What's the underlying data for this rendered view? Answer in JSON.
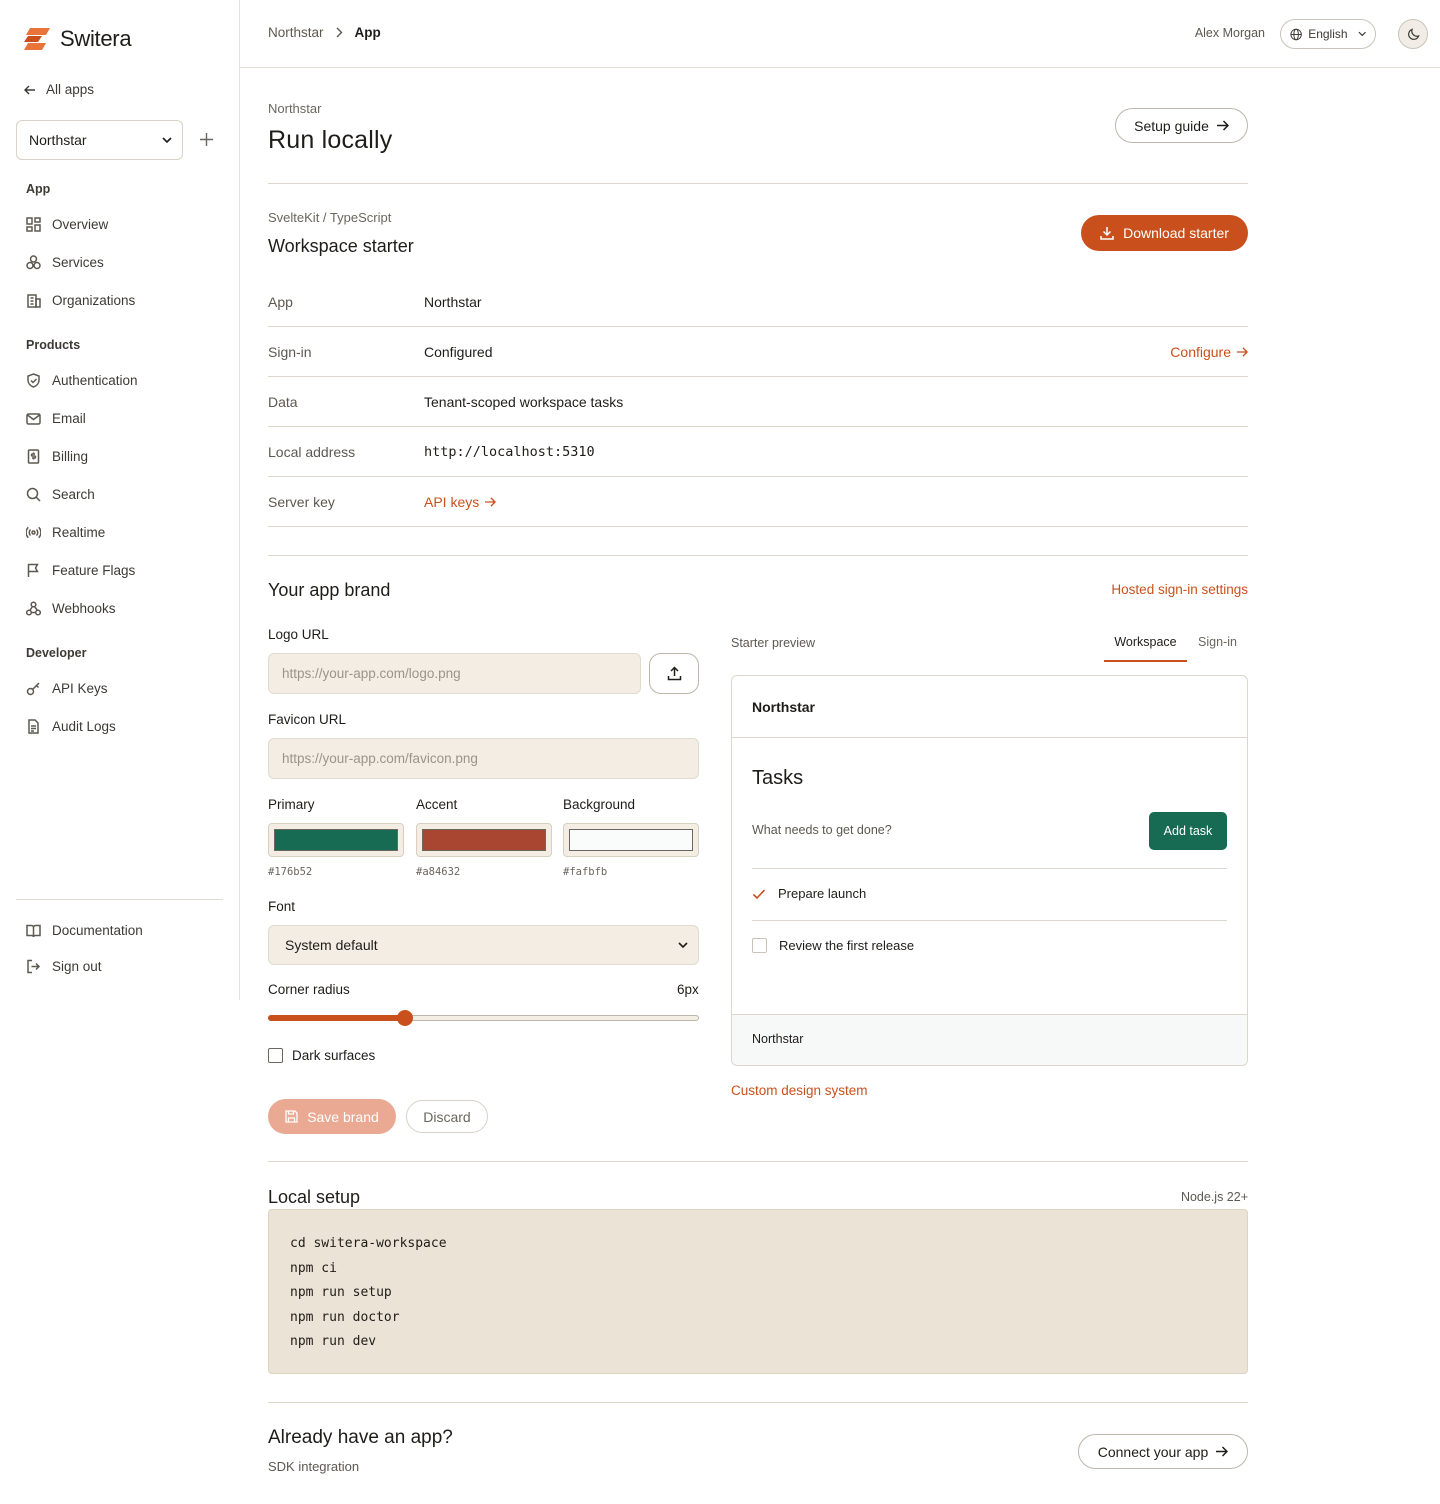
{
  "brand": {
    "name": "Switera"
  },
  "sidebar": {
    "back_label": "All apps",
    "app_select_value": "Northstar",
    "sections": {
      "app": "App",
      "products": "Products",
      "developer": "Developer"
    },
    "app_items": [
      "Overview",
      "Services",
      "Organizations"
    ],
    "product_items": [
      "Authentication",
      "Email",
      "Billing",
      "Search",
      "Realtime",
      "Feature Flags",
      "Webhooks"
    ],
    "developer_items": [
      "API Keys",
      "Audit Logs"
    ],
    "footer_items": [
      "Documentation",
      "Sign out"
    ]
  },
  "topbar": {
    "breadcrumb": [
      "Northstar",
      "App"
    ],
    "user": "Alex Morgan",
    "language": "English"
  },
  "page": {
    "eyebrow": "Northstar",
    "title": "Run locally",
    "setup_guide_label": "Setup guide"
  },
  "starter": {
    "stack": "SvelteKit / TypeScript",
    "title": "Workspace starter",
    "download_label": "Download starter",
    "rows": [
      {
        "key": "App",
        "value": "Northstar"
      },
      {
        "key": "Sign-in",
        "value": "Configured",
        "action": "Configure"
      },
      {
        "key": "Data",
        "value": "Tenant-scoped workspace tasks"
      },
      {
        "key": "Local address",
        "value": "http://localhost:5310"
      },
      {
        "key": "Server key",
        "value": "API keys"
      }
    ]
  },
  "brand_form": {
    "title": "Your app brand",
    "hosted_link": "Hosted sign-in settings",
    "logo_label": "Logo URL",
    "logo_placeholder": "https://your-app.com/logo.png",
    "favicon_label": "Favicon URL",
    "favicon_placeholder": "https://your-app.com/favicon.png",
    "colors": [
      {
        "label": "Primary",
        "hex": "#176b52"
      },
      {
        "label": "Accent",
        "hex": "#a84632"
      },
      {
        "label": "Background",
        "hex": "#fafbfb"
      }
    ],
    "font_label": "Font",
    "font_value": "System default",
    "radius_label": "Corner radius",
    "radius_value": "6px",
    "radius_fraction": 0.31,
    "dark_surfaces_label": "Dark surfaces",
    "dark_surfaces_checked": false,
    "save_label": "Save brand",
    "discard_label": "Discard"
  },
  "preview": {
    "label": "Starter preview",
    "tabs": [
      "Workspace",
      "Sign-in"
    ],
    "active_tab": "Workspace",
    "app_name": "Northstar",
    "heading": "Tasks",
    "input_placeholder": "What needs to get done?",
    "add_button": "Add task",
    "tasks": [
      {
        "text": "Prepare launch",
        "done": true
      },
      {
        "text": "Review the first release",
        "done": false
      }
    ],
    "footer": "Northstar",
    "custom_link": "Custom design system"
  },
  "local_setup": {
    "title": "Local setup",
    "requirement": "Node.js 22+",
    "commands": [
      "cd switera-workspace",
      "npm ci",
      "npm run setup",
      "npm run doctor",
      "npm run dev"
    ]
  },
  "existing_app": {
    "title": "Already have an app?",
    "subtitle": "SDK integration",
    "connect_label": "Connect your app"
  },
  "colors": {
    "accent": "#c9501d",
    "preview_primary": "#176b52"
  }
}
